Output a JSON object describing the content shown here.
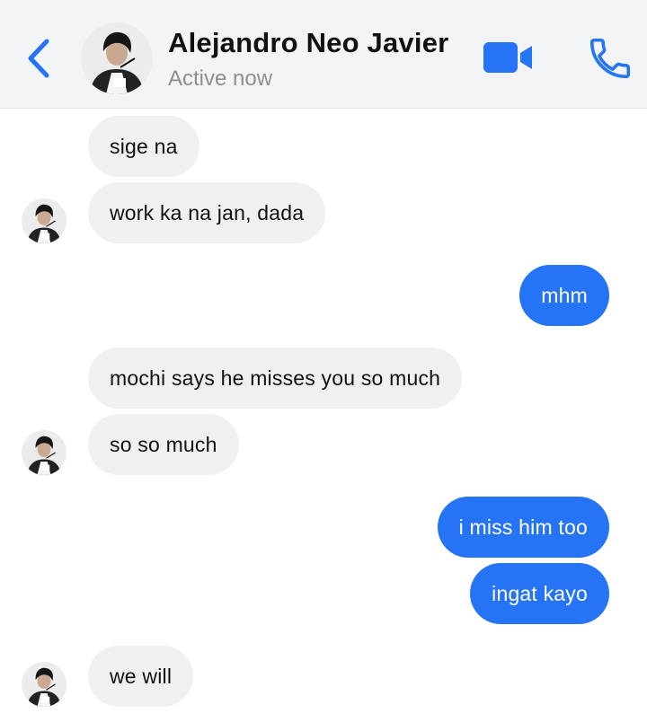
{
  "header": {
    "contact_name": "Alejandro Neo Javier",
    "status": "Active now",
    "icons": {
      "back": "chevron-left-icon",
      "video": "video-camera-icon",
      "call": "phone-icon"
    },
    "accent_color": "#2474f5"
  },
  "messages": [
    {
      "direction": "incoming",
      "text": "sige na"
    },
    {
      "direction": "incoming",
      "text": "work ka na jan, dada"
    },
    {
      "direction": "outgoing",
      "text": "mhm"
    },
    {
      "direction": "incoming",
      "text": "mochi says he misses you so much"
    },
    {
      "direction": "incoming",
      "text": "so so much"
    },
    {
      "direction": "outgoing",
      "text": "i miss him too"
    },
    {
      "direction": "outgoing",
      "text": "ingat kayo"
    },
    {
      "direction": "incoming",
      "text": "we will"
    }
  ],
  "colors": {
    "incoming_bubble": "#f0f0f0",
    "outgoing_bubble": "#2474f5",
    "header_bg": "#f3f4f6"
  }
}
